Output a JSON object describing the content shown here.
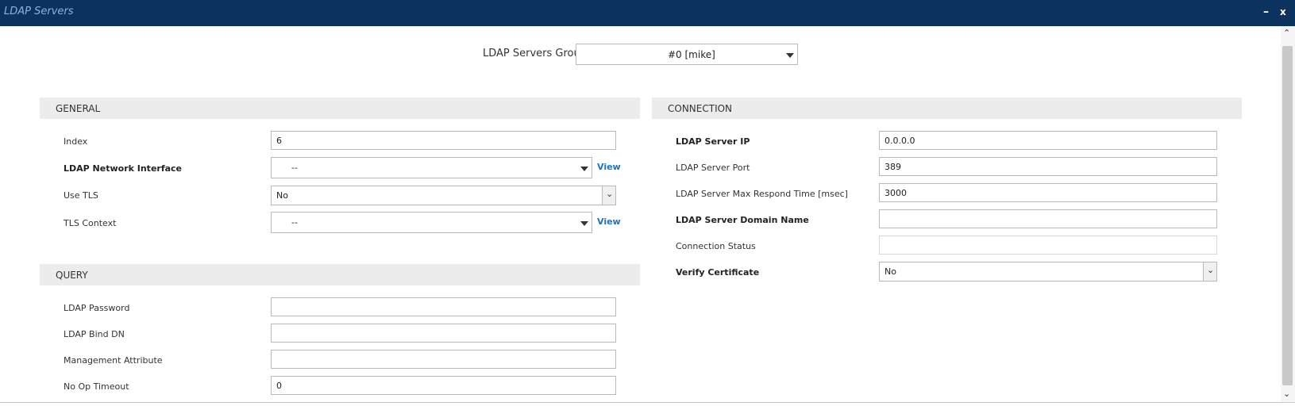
{
  "window": {
    "title": "LDAP Servers",
    "minimize_label": "–",
    "close_label": "x"
  },
  "group_selector": {
    "label": "LDAP Servers Group",
    "value": "#0 [mike]"
  },
  "general": {
    "header": "GENERAL",
    "index_label": "Index",
    "index_value": "6",
    "network_interface_label": "LDAP Network Interface",
    "network_interface_value": "--",
    "network_interface_view": "View",
    "use_tls_label": "Use TLS",
    "use_tls_value": "No",
    "tls_context_label": "TLS Context",
    "tls_context_value": "--",
    "tls_context_view": "View"
  },
  "query": {
    "header": "QUERY",
    "password_label": "LDAP Password",
    "password_value": "",
    "bind_dn_label": "LDAP Bind DN",
    "bind_dn_value": "",
    "mgmt_attr_label": "Management Attribute",
    "mgmt_attr_value": "",
    "no_op_label": "No Op Timeout",
    "no_op_value": "0"
  },
  "connection": {
    "header": "CONNECTION",
    "server_ip_label": "LDAP Server IP",
    "server_ip_value": "0.0.0.0",
    "server_port_label": "LDAP Server Port",
    "server_port_value": "389",
    "max_respond_label": "LDAP Server Max Respond Time [msec]",
    "max_respond_value": "3000",
    "domain_name_label": "LDAP Server Domain Name",
    "domain_name_value": "",
    "status_label": "Connection Status",
    "status_value": "",
    "verify_cert_label": "Verify Certificate",
    "verify_cert_value": "No"
  },
  "colors": {
    "titlebar": "#0c3360",
    "title_text": "#8fb2db",
    "link": "#1a73c7",
    "section_bg": "#ececec"
  }
}
